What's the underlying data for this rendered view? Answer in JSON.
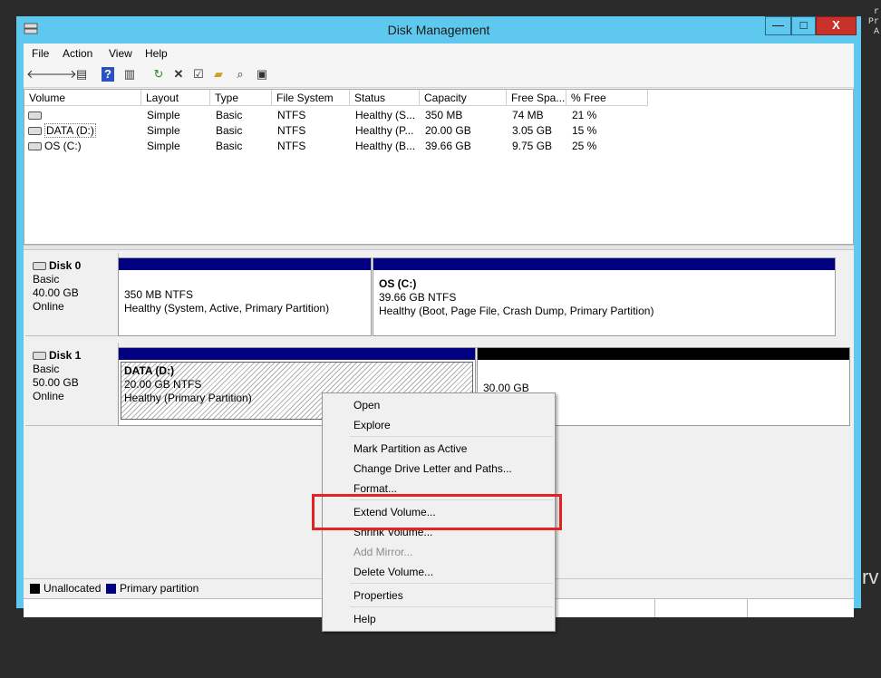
{
  "edge": {
    "top_lines": [
      "r",
      "Pr",
      "A"
    ],
    "side_text": "rv"
  },
  "window": {
    "title": "Disk Management",
    "controls": {
      "minimize": "—",
      "maximize": "□",
      "close": "X"
    }
  },
  "menu": [
    "File",
    "Action",
    "View",
    "Help"
  ],
  "toolbar_icons": [
    "back-arrow-icon",
    "forward-arrow-icon",
    "console-tree-icon",
    "help-icon",
    "properties-pane-icon",
    "refresh-icon",
    "delete-icon",
    "properties-icon",
    "open-icon",
    "find-icon",
    "rescan-icon"
  ],
  "volumes": {
    "columns": [
      "Volume",
      "Layout",
      "Type",
      "File System",
      "Status",
      "Capacity",
      "Free Spa...",
      "% Free"
    ],
    "rows": [
      [
        "",
        "Simple",
        "Basic",
        "NTFS",
        "Healthy (S...",
        "350 MB",
        "74 MB",
        "21 %"
      ],
      [
        "DATA (D:)",
        "Simple",
        "Basic",
        "NTFS",
        "Healthy (P...",
        "20.00 GB",
        "3.05 GB",
        "15 %"
      ],
      [
        "OS (C:)",
        "Simple",
        "Basic",
        "NTFS",
        "Healthy (B...",
        "39.66 GB",
        "9.75 GB",
        "25 %"
      ]
    ]
  },
  "disks": [
    {
      "name": "Disk 0",
      "type": "Basic",
      "size": "40.00 GB",
      "state": "Online",
      "partitions": [
        {
          "title": "",
          "size": "350 MB NTFS",
          "status": "Healthy (System, Active, Primary Partition)"
        },
        {
          "title": "OS  (C:)",
          "size": "39.66 GB NTFS",
          "status": "Healthy (Boot, Page File, Crash Dump, Primary Partition)"
        }
      ]
    },
    {
      "name": "Disk 1",
      "type": "Basic",
      "size": "50.00 GB",
      "state": "Online",
      "partitions": [
        {
          "title": "DATA  (D:)",
          "size": "20.00 GB NTFS",
          "status": "Healthy (Primary Partition)"
        },
        {
          "title": "",
          "size": "30.00 GB",
          "status": ""
        }
      ]
    }
  ],
  "legend": {
    "unallocated": "Unallocated",
    "primary": "Primary partition"
  },
  "colors": {
    "primary": "#000080",
    "unallocated": "#000000",
    "titlebar": "#5ec8ee",
    "highlight": "#e02424"
  },
  "context_menu": {
    "open": "Open",
    "explore": "Explore",
    "mark_active": "Mark Partition as Active",
    "change_letter": "Change Drive Letter and Paths...",
    "format": "Format...",
    "extend": "Extend Volume...",
    "shrink": "Shrink Volume...",
    "add_mirror": "Add Mirror...",
    "delete": "Delete Volume...",
    "properties": "Properties",
    "help": "Help"
  }
}
